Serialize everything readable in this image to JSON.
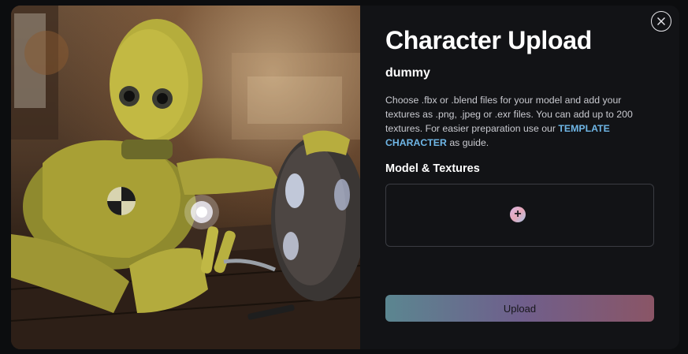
{
  "modal": {
    "title": "Character Upload",
    "character_name": "dummy",
    "description_prefix": "Choose .fbx or .blend files for your model and add your textures as .png, .jpeg or .exr files. You can add up to 200 textures. For easier preparation use our",
    "template_link": "TEMPLATE CHARACTER",
    "description_suffix": "as guide.",
    "section_label": "Model & Textures",
    "add_icon": "plus-icon",
    "upload_label": "Upload",
    "close_icon": "close-icon"
  },
  "colors": {
    "background": "#121316",
    "link": "#6fb6e6",
    "upload_gradient": [
      "#5b8690",
      "#6f5f8c",
      "#8a5566"
    ]
  }
}
